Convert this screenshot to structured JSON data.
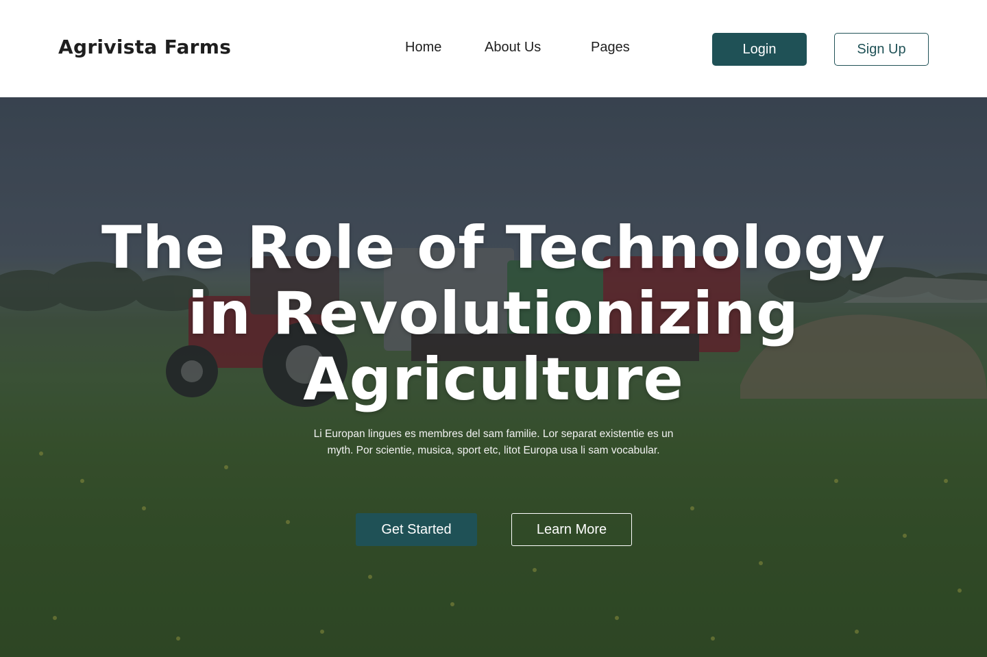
{
  "header": {
    "brand": "Agrivista Farms",
    "nav": {
      "home": "Home",
      "about": "About Us",
      "pages": "Pages"
    },
    "login_label": "Login",
    "signup_label": "Sign Up"
  },
  "hero": {
    "title": "The Role of Technology in Revolutionizing Agriculture",
    "subtitle": "Li Europan lingues es membres del sam familie. Lor separat existentie es un myth. Por scientie, musica, sport etc, litot Europa usa li sam vocabular.",
    "primary_cta": "Get Started",
    "secondary_cta": "Learn More"
  },
  "colors": {
    "accent": "#1f5156",
    "text_dark": "#1e1e1e",
    "hero_text": "#ffffff"
  }
}
